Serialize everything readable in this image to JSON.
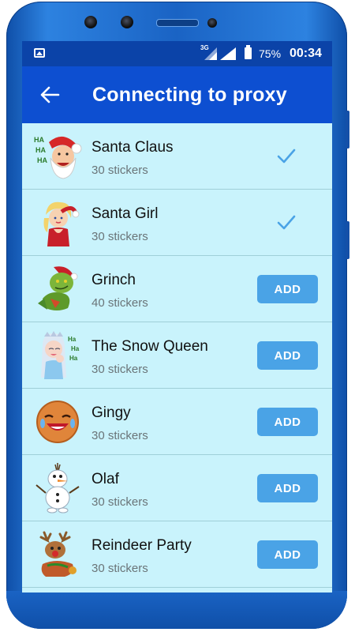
{
  "status_bar": {
    "network": "3G",
    "battery_percent": "75%",
    "time": "00:34"
  },
  "app_bar": {
    "title": "Connecting to proxy",
    "back_icon": "arrow-left-icon"
  },
  "colors": {
    "app_bar": "#0d4fd1",
    "status_bar": "#0b43a8",
    "list_background": "#c9f3fc",
    "add_button": "#4aa3e6",
    "check": "#4aa3e6"
  },
  "sticker_packs": [
    {
      "name": "Santa Claus",
      "count": "30 stickers",
      "installed": true,
      "action": "check-icon"
    },
    {
      "name": "Santa Girl",
      "count": "30 stickers",
      "installed": true,
      "action": "check-icon"
    },
    {
      "name": "Grinch",
      "count": "40 stickers",
      "installed": false,
      "action": "ADD"
    },
    {
      "name": "The Snow Queen",
      "count": "30 stickers",
      "installed": false,
      "action": "ADD"
    },
    {
      "name": "Gingy",
      "count": "30 stickers",
      "installed": false,
      "action": "ADD"
    },
    {
      "name": "Olaf",
      "count": "30 stickers",
      "installed": false,
      "action": "ADD"
    },
    {
      "name": "Reindeer Party",
      "count": "30 stickers",
      "installed": false,
      "action": "ADD"
    }
  ]
}
